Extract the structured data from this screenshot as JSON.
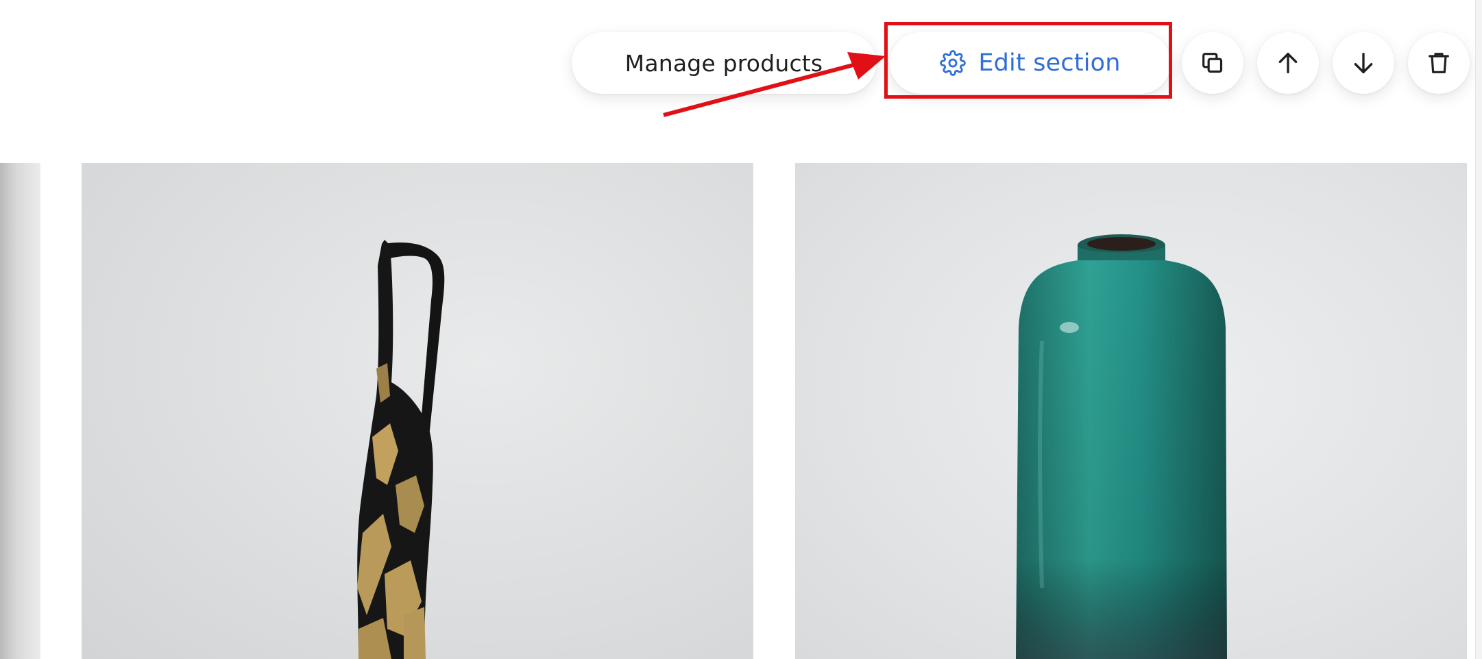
{
  "toolbar": {
    "manage_products_label": "Manage products",
    "edit_section_label": "Edit section",
    "icons": {
      "edit": "gear-icon",
      "duplicate": "duplicate-icon",
      "move_up": "arrow-up-icon",
      "move_down": "arrow-down-icon",
      "delete": "trash-icon"
    }
  },
  "annotation": {
    "highlight_color": "#e01016"
  },
  "colors": {
    "accent": "#2f6fd6",
    "text": "#1f1f1f"
  },
  "products": [
    {
      "image": "black-and-gold-pitcher-vase"
    },
    {
      "image": "teal-patina-vase"
    }
  ]
}
